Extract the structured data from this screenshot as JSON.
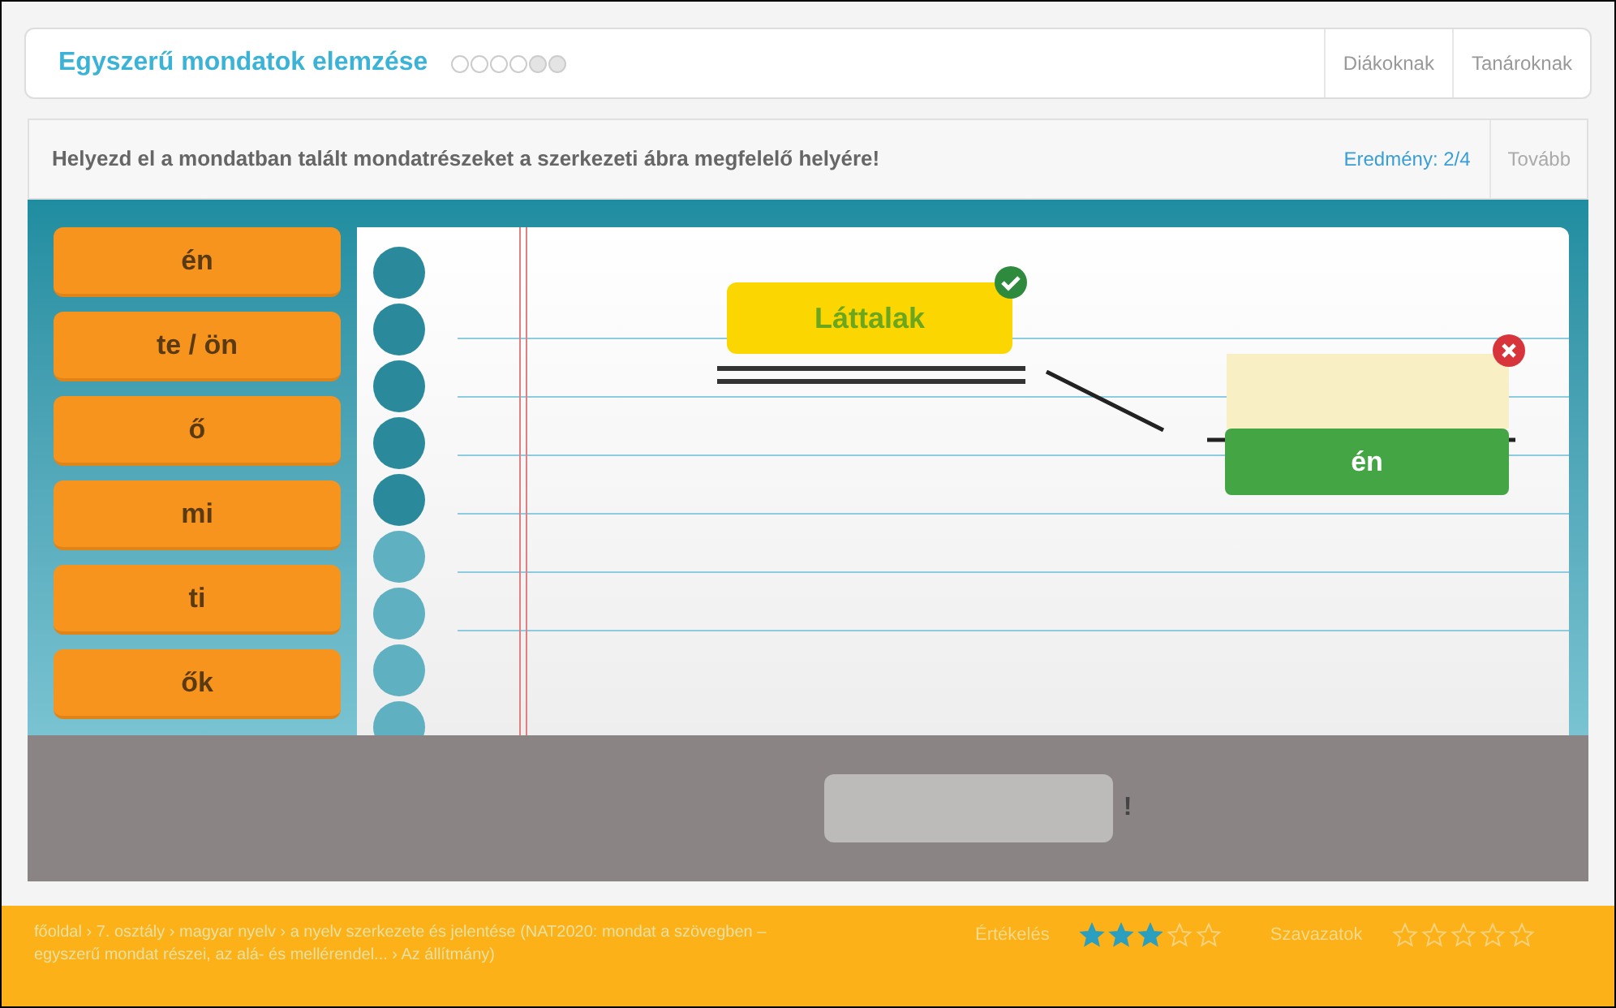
{
  "header": {
    "title": "Egyszerű mondatok elemzése",
    "progress": [
      {
        "done": true
      },
      {
        "done": true
      },
      {
        "done": true
      },
      {
        "done": true
      },
      {
        "done": false
      },
      {
        "done": false
      }
    ],
    "links": [
      "Diákoknak",
      "Tanároknak"
    ]
  },
  "task": {
    "instruction": "Helyezd el a mondatban talált mondatrészeket a szerkezeti ábra megfelelő helyére!",
    "score": "Eredmény: 2/4",
    "next": "Tovább"
  },
  "word_bank": [
    "én",
    "te / ön",
    "ő",
    "mi",
    "ti",
    "ők"
  ],
  "diagram": {
    "predicate": {
      "text": "Láttalak",
      "correct": true
    },
    "subject": {
      "text": "én",
      "correct": false
    }
  },
  "answer": {
    "punctuation": "!"
  },
  "footer": {
    "breadcrumb": "főoldal › 7. osztály › magyar nyelv › a nyelv szerkezete és jelentése (NAT2020: mondat a szövegben – egyszerű mondat részei, az alá- és mellérendel... › Az állítmány)",
    "rating": {
      "label": "Értékelés",
      "stars": 3
    },
    "votes": {
      "label": "Szavazatok",
      "stars": 0
    }
  }
}
